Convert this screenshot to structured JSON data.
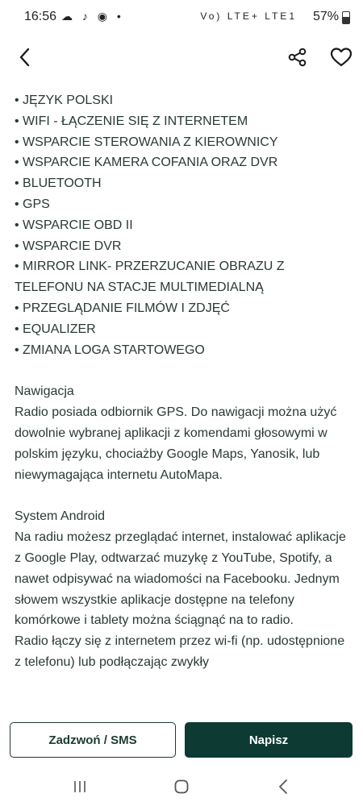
{
  "status_bar": {
    "time": "16:56",
    "left_icons": "☁ ♪ ◉ •",
    "signal_text": "Vo) LTE+ LTE1",
    "battery": "57%"
  },
  "topbar": {
    "back_icon": "chevron-left-icon",
    "share_icon": "share-icon",
    "favorite_icon": "heart-outline-icon"
  },
  "features": [
    "JĘZYK POLSKI",
    "WIFI - ŁĄCZENIE SIĘ Z INTERNETEM",
    "WSPARCIE STEROWANIA Z KIEROWNICY",
    "WSPARCIE KAMERA COFANIA ORAZ DVR",
    "BLUETOOTH",
    "GPS",
    "WSPARCIE OBD II",
    "WSPARCIE DVR",
    "MIRROR LINK- PRZERZUCANIE OBRAZU Z TELEFONU NA STACJE MULTIMEDIALNĄ",
    "PRZEGLĄDANIE FILMÓW I ZDJĘĆ",
    "EQUALIZER",
    "ZMIANA LOGA STARTOWEGO"
  ],
  "navigation_section": {
    "heading": "Nawigacja",
    "body": "Radio posiada odbiornik GPS. Do nawigacji można użyć dowolnie wybranej aplikacji z komendami głosowymi w polskim języku, chociażby Google Maps, Yanosik, lub niewymagająca internetu AutoMapa."
  },
  "android_section": {
    "heading": "System Android",
    "body": "Na radiu możesz przeglądać internet, instalować aplikacje z Google Play, odtwarzać muzykę z YouTube, Spotify, a nawet odpisywać na wiadomości na Facebooku. Jednym słowem wszystkie aplikacje dostępne na telefony komórkowe i tablety można ściągnąć na to radio.",
    "body2": "Radio łączy się z internetem przez wi-fi (np. udostępnione z telefonu) lub podłączając zwykły"
  },
  "actions": {
    "call_label": "Zadzwoń / SMS",
    "write_label": "Napisz"
  },
  "colors": {
    "primary": "#0d3a33",
    "text": "#2a3a36"
  }
}
